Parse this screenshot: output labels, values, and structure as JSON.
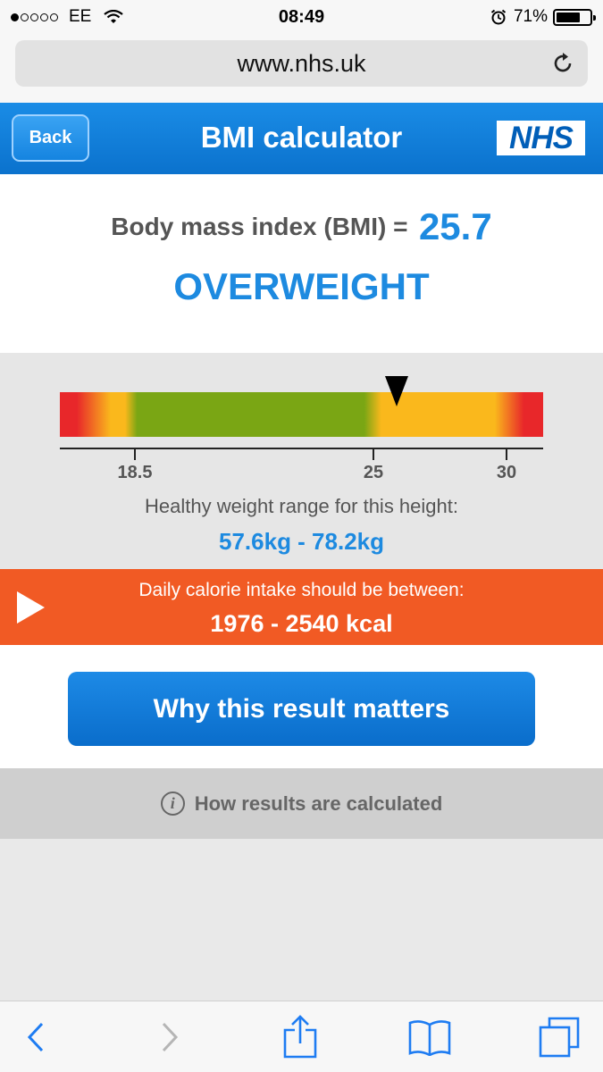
{
  "status_bar": {
    "carrier": "EE",
    "time": "08:49",
    "battery": "71%",
    "battery_level": 0.71
  },
  "browser": {
    "url": "www.nhs.uk"
  },
  "header": {
    "back_label": "Back",
    "title": "BMI calculator",
    "logo_text": "NHS"
  },
  "result": {
    "bmi_label": "Body mass index (BMI) =",
    "bmi_value": "25.7",
    "category": "OVERWEIGHT"
  },
  "scale": {
    "ticks": [
      "18.5",
      "25",
      "30"
    ],
    "marker_value": 25.7,
    "healthy_label": "Healthy weight range for this height:",
    "healthy_range": "57.6kg - 78.2kg"
  },
  "calories": {
    "label": "Daily calorie intake should be between:",
    "range": "1976 - 2540 kcal"
  },
  "actions": {
    "why_label": "Why this result matters",
    "how_label": "How results are calculated"
  },
  "colors": {
    "nhs_blue": "#005eb8",
    "accent_blue": "#1d8ae0",
    "calorie_orange": "#f15a24",
    "scale_red": "#e8272a",
    "scale_yellow": "#fab81c",
    "scale_green": "#7aa614"
  }
}
